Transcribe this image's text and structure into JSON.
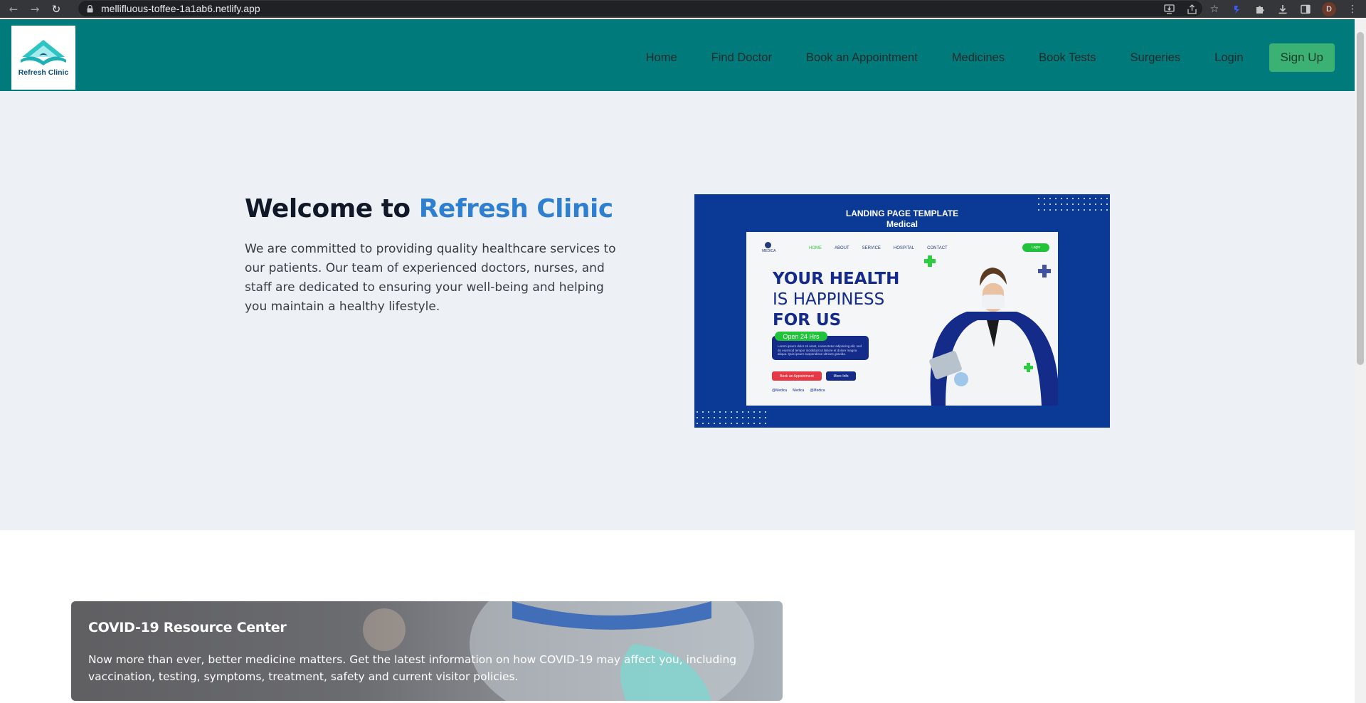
{
  "browser": {
    "url": "mellifluous-toffee-1a1ab6.netlify.app",
    "profile_initial": "D",
    "icons": [
      "back-icon",
      "forward-icon",
      "reload-icon",
      "lock-icon",
      "install-icon",
      "share-icon",
      "star-icon",
      "extension-icon",
      "puzzle-icon",
      "download-icon",
      "sidepanel-icon",
      "menu-icon"
    ]
  },
  "header": {
    "logo_text": "Refresh Clinic",
    "nav": [
      "Home",
      "Find Doctor",
      "Book an Appointment",
      "Medicines",
      "Book Tests",
      "Surgeries",
      "Login"
    ],
    "signup_label": "Sign Up",
    "colors": {
      "header_bg": "#007a7a",
      "signup_bg": "#3bb273"
    }
  },
  "hero": {
    "title_prefix": "Welcome to ",
    "title_accent": "Refresh Clinic",
    "description": "We are committed to providing quality healthcare services to our patients. Our team of experienced doctors, nurses, and staff are dedicated to ensuring your well-being and helping you maintain a healthy lifestyle.",
    "accent_color": "#2f7fd0",
    "image": {
      "template_title_line1": "LANDING PAGE TEMPLATE",
      "template_title_line2": "Medical",
      "mock_logo": "MEDICA",
      "mock_nav": [
        "HOME",
        "ABOUT",
        "SERVICE",
        "HOSPITAL",
        "CONTACT"
      ],
      "mock_login": "Login",
      "headline_line1": "YOUR HEALTH",
      "headline_line2": "IS HAPPINESS",
      "headline_line3": "FOR US",
      "open_badge": "Open 24 Hrs",
      "lorem": "Lorem ipsum dolor sit amet, consectetur adipiscing elit, sed do eiusmod tempor incididunt ut labore et dolore magna aliqua. Quis ipsum suspendisse ultrices gravida.",
      "btn_primary": "Book an Appointment",
      "btn_secondary": "More Info",
      "socials": [
        "@Medica",
        "Medica",
        "@Medica"
      ]
    }
  },
  "covid": {
    "title": "COVID-19 Resource Center",
    "text": "Now more than ever, better medicine matters. Get the latest information on how COVID-19 may affect you, including vaccination, testing, symptoms, treatment, safety and current visitor policies."
  }
}
